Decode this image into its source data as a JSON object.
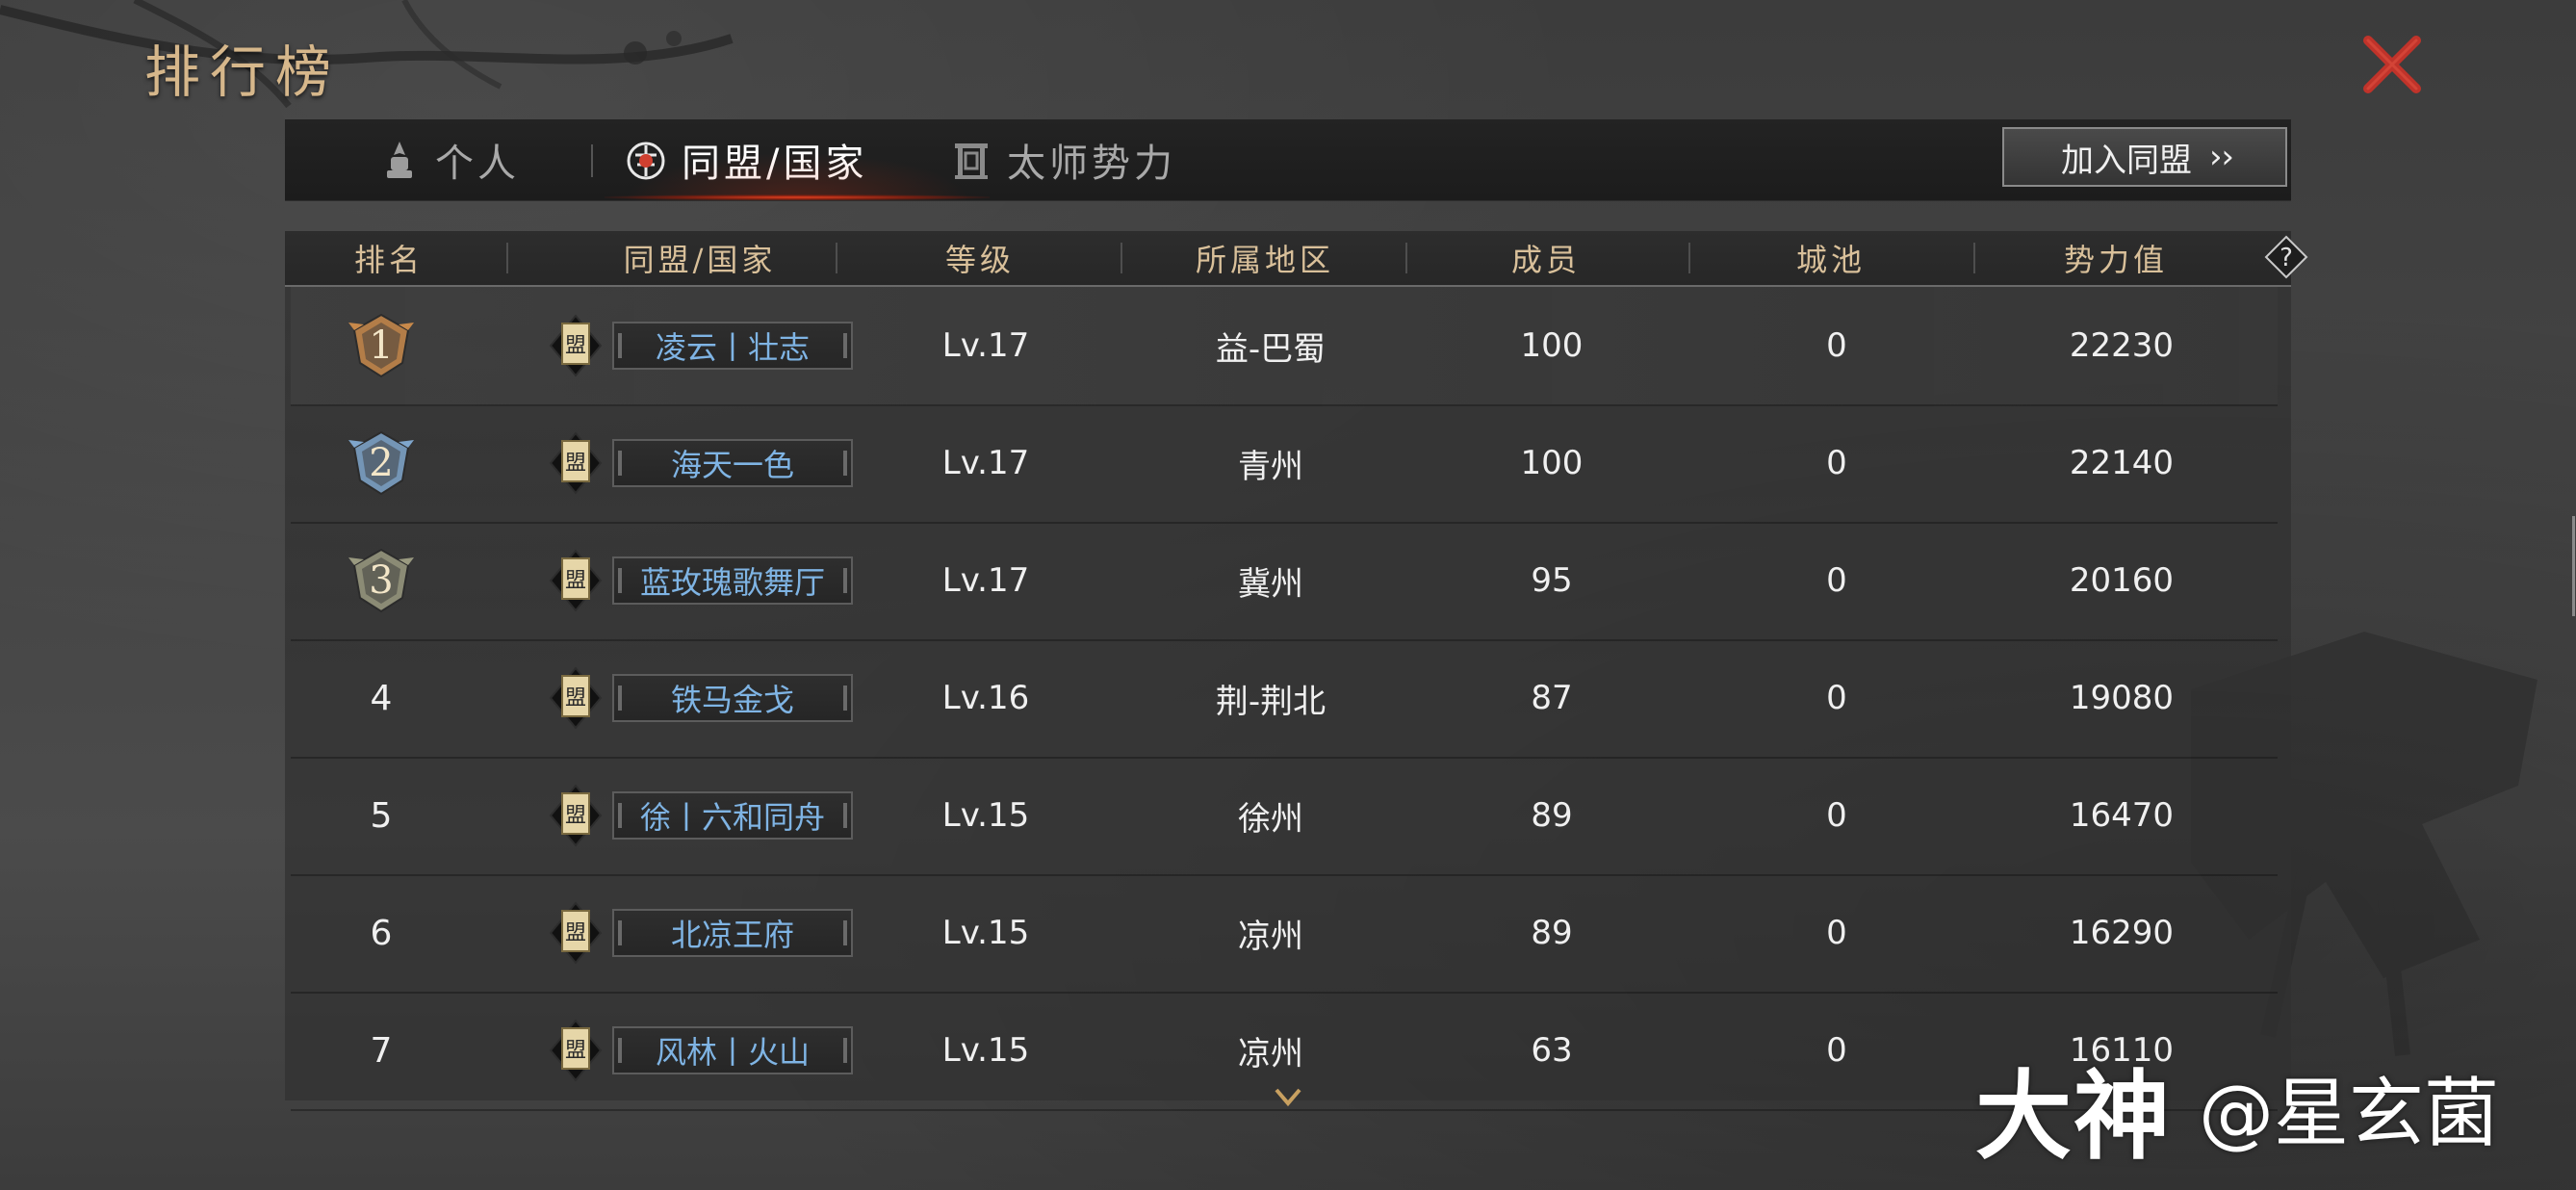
{
  "page": {
    "title": "排行榜"
  },
  "tabs": [
    {
      "label": "个人",
      "icon": "person-helmet-icon",
      "active": false
    },
    {
      "label": "同盟/国家",
      "icon": "alliance-emblem-icon",
      "active": true
    },
    {
      "label": "太师势力",
      "icon": "taishi-gate-icon",
      "active": false
    }
  ],
  "join_button": {
    "label": "加入同盟",
    "icon": "double-chevron-right-icon"
  },
  "columns": [
    "排名",
    "同盟/国家",
    "等级",
    "所属地区",
    "成员",
    "城池",
    "势力值"
  ],
  "rows": [
    {
      "rank": "1",
      "alliance_icon_char": "盟",
      "alliance": "凌云丨壮志",
      "level": "Lv.17",
      "region": "益-巴蜀",
      "members": "100",
      "cities": "0",
      "power": "22230"
    },
    {
      "rank": "2",
      "alliance_icon_char": "盟",
      "alliance": "海天一色",
      "level": "Lv.17",
      "region": "青州",
      "members": "100",
      "cities": "0",
      "power": "22140"
    },
    {
      "rank": "3",
      "alliance_icon_char": "盟",
      "alliance": "蓝玫瑰歌舞厅",
      "level": "Lv.17",
      "region": "冀州",
      "members": "95",
      "cities": "0",
      "power": "20160"
    },
    {
      "rank": "4",
      "alliance_icon_char": "盟",
      "alliance": "铁马金戈",
      "level": "Lv.16",
      "region": "荆-荆北",
      "members": "87",
      "cities": "0",
      "power": "19080"
    },
    {
      "rank": "5",
      "alliance_icon_char": "盟",
      "alliance": "徐丨六和同舟",
      "level": "Lv.15",
      "region": "徐州",
      "members": "89",
      "cities": "0",
      "power": "16470"
    },
    {
      "rank": "6",
      "alliance_icon_char": "盟",
      "alliance": "北凉王府",
      "level": "Lv.15",
      "region": "凉州",
      "members": "89",
      "cities": "0",
      "power": "16290"
    },
    {
      "rank": "7",
      "alliance_icon_char": "盟",
      "alliance": "风林丨火山",
      "level": "Lv.15",
      "region": "凉州",
      "members": "63",
      "cities": "0",
      "power": "16110"
    }
  ],
  "medal_colors": {
    "gold": "#c8894a",
    "silver": "#7fa6cc",
    "bronze": "#9a9a80"
  },
  "colors": {
    "title": "#d6b78b",
    "header_text": "#d9c09a",
    "alliance_name": "#7fb4e4",
    "close_x": "#c0332a",
    "active_tab_accent": "#e04020"
  },
  "icons": {
    "close": "close-x-icon",
    "help": "question-diamond-icon",
    "scroll": "down-chevron-icon"
  },
  "watermark": {
    "big": "大神",
    "handle": "@星玄菌"
  }
}
